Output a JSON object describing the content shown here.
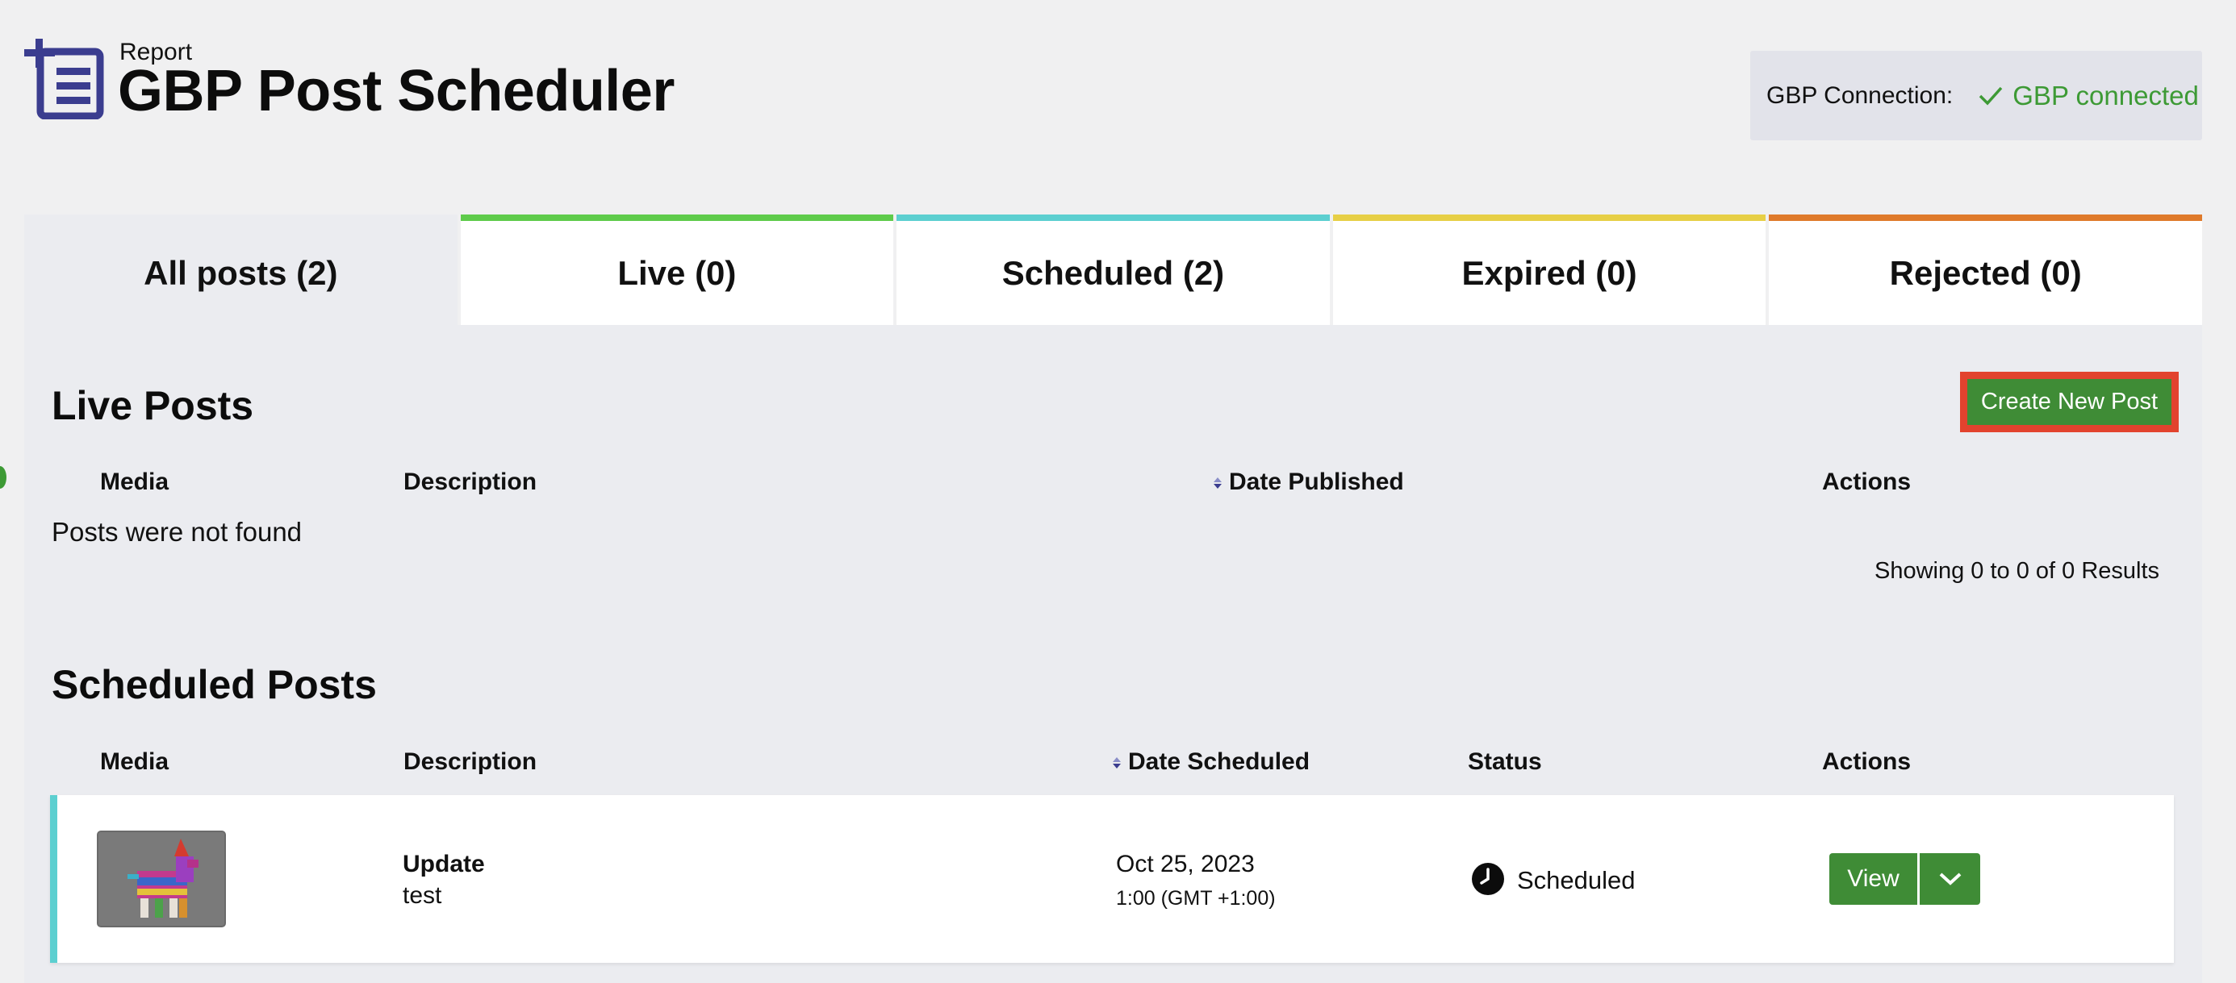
{
  "header": {
    "subtitle": "Report",
    "title": "GBP Post Scheduler",
    "logo_icon": "add-list-icon",
    "accent": "#3b3d8f"
  },
  "connection": {
    "label": "GBP Connection:",
    "status": "GBP connected",
    "status_icon": "check-icon",
    "status_color": "#3d9a35"
  },
  "tabs": [
    {
      "label": "All posts (2)",
      "color": "#ebecf0"
    },
    {
      "label": "Live (0)",
      "color": "#5ecb4b"
    },
    {
      "label": "Scheduled (2)",
      "color": "#5ccfd0"
    },
    {
      "label": "Expired (0)",
      "color": "#e7cf46"
    },
    {
      "label": "Rejected (0)",
      "color": "#df7a2b"
    }
  ],
  "live": {
    "title": "Live Posts",
    "create_button": "Create New Post",
    "columns": {
      "media": "Media",
      "description": "Description",
      "date": "Date Published",
      "actions": "Actions"
    },
    "empty_message": "Posts were not found",
    "showing": "Showing 0 to 0 of 0 Results"
  },
  "scheduled": {
    "title": "Scheduled Posts",
    "columns": {
      "media": "Media",
      "description": "Description",
      "date": "Date Scheduled",
      "status": "Status",
      "actions": "Actions"
    },
    "rows": [
      {
        "media": "pinata-thumbnail",
        "description_title": "Update",
        "description_text": "test",
        "date": "Oct 25, 2023",
        "time": "1:00 (GMT +1:00)",
        "status": "Scheduled",
        "status_icon": "clock-icon",
        "view_label": "View",
        "dropdown_icon": "chevron-down-icon"
      }
    ]
  },
  "colors": {
    "primary_button": "#3f8c36",
    "highlight_border": "#e2432e",
    "background": "#f0f0f1",
    "panel": "#ebecf0"
  }
}
